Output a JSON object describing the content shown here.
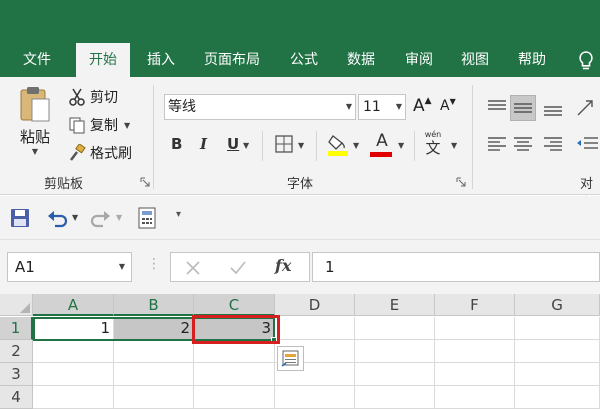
{
  "tabs": [
    {
      "label": "文件"
    },
    {
      "label": "开始"
    },
    {
      "label": "插入"
    },
    {
      "label": "页面布局"
    },
    {
      "label": "公式"
    },
    {
      "label": "数据"
    },
    {
      "label": "审阅"
    },
    {
      "label": "视图"
    },
    {
      "label": "帮助"
    }
  ],
  "active_tab": "开始",
  "clipboard": {
    "paste_label": "粘贴",
    "cut_label": "剪切",
    "copy_label": "复制",
    "format_painter_label": "格式刷",
    "group_label": "剪贴板"
  },
  "font": {
    "font_name": "等线",
    "font_size": "11",
    "grow_label": "A",
    "shrink_label": "A",
    "bold_label": "B",
    "italic_label": "I",
    "underline_label": "U",
    "font_color_label": "A",
    "phonetic_label": "文",
    "phonetic_top": "wén",
    "group_label": "字体"
  },
  "alignment": {
    "group_label": "对齐"
  },
  "colors": {
    "brand": "#217346",
    "highlight": "#ffff00",
    "font_color": "#e00000",
    "annotation": "#d61f1f"
  },
  "formula_bar": {
    "name_box": "A1",
    "formula": "1",
    "fx_label": "fx"
  },
  "grid": {
    "columns": [
      "A",
      "B",
      "C",
      "D",
      "E",
      "F",
      "G"
    ],
    "rows": [
      "1",
      "2",
      "3",
      "4"
    ],
    "row1_values": [
      "1",
      "2",
      "3"
    ]
  },
  "icons": [
    "save-icon",
    "undo-icon",
    "redo-icon",
    "form-icon",
    "lightbulb-icon",
    "paste-icon",
    "scissors-icon",
    "copy-icon",
    "brush-icon",
    "border-icon",
    "fill-color-icon",
    "cancel-icon",
    "enter-icon",
    "quick-analysis-icon"
  ]
}
